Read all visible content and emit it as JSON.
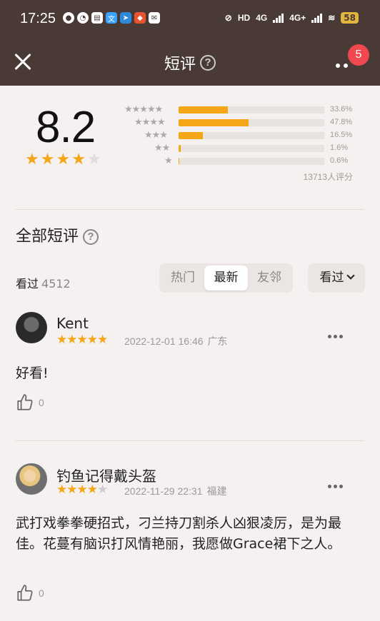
{
  "status_bar": {
    "time": "17:25",
    "hd": "HD",
    "net1": "4G",
    "net2": "4G+",
    "battery": "58",
    "app_icons": [
      "message-icon",
      "clock-icon",
      "calendar-icon",
      "translate-icon",
      "telegram-icon",
      "app-icon",
      "mail-icon"
    ]
  },
  "nav": {
    "title": "短评",
    "help": "?",
    "badge": "5"
  },
  "rating": {
    "score": "8.2",
    "stars_value": 4,
    "stars_max": 5,
    "distribution": [
      {
        "stars": "★★★★★",
        "percent_label": "33.6%",
        "percent": 33.6
      },
      {
        "stars": "★★★★",
        "percent_label": "47.8%",
        "percent": 47.8
      },
      {
        "stars": "★★★",
        "percent_label": "16.5%",
        "percent": 16.5
      },
      {
        "stars": "★★",
        "percent_label": "1.6%",
        "percent": 1.6
      },
      {
        "stars": "★",
        "percent_label": "0.6%",
        "percent": 0.6
      }
    ],
    "total": "13713人评分"
  },
  "section": {
    "title": "全部短评",
    "help": "?"
  },
  "toolbar": {
    "seen_label": "看过",
    "seen_count": "4512",
    "tabs": [
      "热门",
      "最新",
      "友邻"
    ],
    "active_tab": "最新",
    "filter_label": "看过"
  },
  "reviews": [
    {
      "name": "Kent",
      "stars": 5,
      "date": "2022-12-01 16:46",
      "location": "广东",
      "text": "好看!",
      "likes": "0"
    },
    {
      "name": "钓鱼记得戴头盔",
      "stars": 4,
      "date": "2022-11-29 22:31",
      "location": "福建",
      "text": "武打戏拳拳硬招式，刁兰持刀割杀人凶狠凌厉，是为最佳。花蔓有脑识打风情艳丽，我愿做Grace裙下之人。",
      "likes": "0"
    }
  ],
  "colors": {
    "header_bg": "#4a3a36",
    "star": "#f4a616",
    "badge": "#f0484e",
    "page_bg": "#f5f1f0"
  }
}
